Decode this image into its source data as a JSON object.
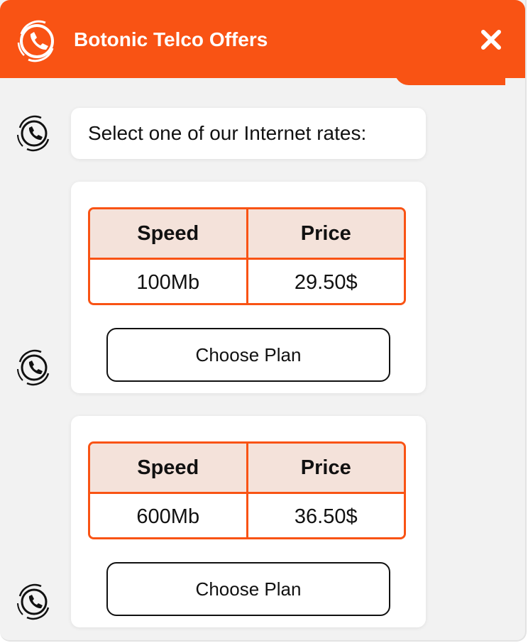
{
  "header": {
    "title": "Botonic Telco Offers",
    "logo_icon": "phone-circle-icon",
    "close_icon": "close-icon",
    "background": "#f95314"
  },
  "messages": [
    {
      "type": "text",
      "text": "Select one of our Internet rates:"
    },
    {
      "type": "plan",
      "columns": [
        "Speed",
        "Price"
      ],
      "speed": "100Mb",
      "price": "29.50$",
      "button_label": "Choose Plan"
    },
    {
      "type": "plan",
      "columns": [
        "Speed",
        "Price"
      ],
      "speed": "600Mb",
      "price": "36.50$",
      "button_label": "Choose Plan"
    }
  ],
  "bot_avatar_icon": "phone-circle-icon",
  "colors": {
    "accent": "#f95314",
    "table_header_bg": "#f4e2da",
    "chat_bg": "#f2f2f2"
  }
}
